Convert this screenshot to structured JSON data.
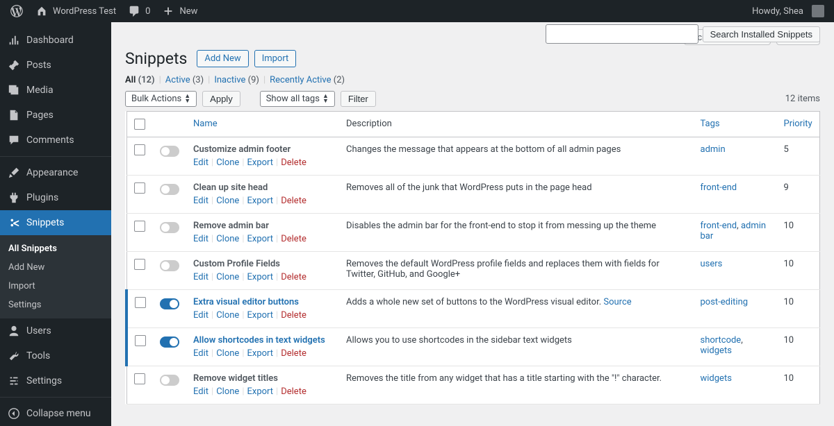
{
  "adminbar": {
    "site_name": "WordPress Test",
    "comment_count": "0",
    "new_label": "New",
    "howdy": "Howdy, Shea"
  },
  "sidebar": {
    "items": [
      {
        "icon": "dashboard",
        "label": "Dashboard"
      },
      {
        "icon": "pin",
        "label": "Posts"
      },
      {
        "icon": "media",
        "label": "Media"
      },
      {
        "icon": "page",
        "label": "Pages"
      },
      {
        "icon": "comment",
        "label": "Comments"
      },
      {
        "sep": true
      },
      {
        "icon": "brush",
        "label": "Appearance"
      },
      {
        "icon": "plugin",
        "label": "Plugins"
      },
      {
        "icon": "scissors",
        "label": "Snippets",
        "active": true,
        "submenu": [
          "All Snippets",
          "Add New",
          "Import",
          "Settings"
        ],
        "submenu_active": 0
      },
      {
        "icon": "user",
        "label": "Users"
      },
      {
        "icon": "tool",
        "label": "Tools"
      },
      {
        "icon": "settings",
        "label": "Settings"
      },
      {
        "sep": true
      },
      {
        "icon": "collapse",
        "label": "Collapse menu"
      }
    ]
  },
  "top": {
    "screen_options": "Screen Options",
    "help": "Help"
  },
  "header": {
    "title": "Snippets",
    "add_new": "Add New",
    "import": "Import"
  },
  "search": {
    "button": "Search Installed Snippets"
  },
  "views": [
    {
      "label": "All",
      "count": "(12)",
      "current": true
    },
    {
      "label": "Active",
      "count": "(3)"
    },
    {
      "label": "Inactive",
      "count": "(9)"
    },
    {
      "label": "Recently Active",
      "count": "(2)"
    }
  ],
  "bulk": {
    "actions_label": "Bulk Actions",
    "apply": "Apply",
    "tags_label": "Show all tags",
    "filter": "Filter"
  },
  "pagination": {
    "items": "12 items"
  },
  "columns": {
    "name": "Name",
    "description": "Description",
    "tags": "Tags",
    "priority": "Priority"
  },
  "row_actions": {
    "edit": "Edit",
    "clone": "Clone",
    "export": "Export",
    "delete": "Delete"
  },
  "snippets": [
    {
      "title": "Customize admin footer",
      "desc": "Changes the message that appears at the bottom of all admin pages",
      "tags": [
        "admin"
      ],
      "priority": "5",
      "active": false
    },
    {
      "title": "Clean up site head",
      "desc": "Removes all of the junk that WordPress puts in the page head",
      "tags": [
        "front-end"
      ],
      "priority": "9",
      "active": false
    },
    {
      "title": "Remove admin bar",
      "desc": "Disables the admin bar for the front-end to stop it from messing up the theme",
      "tags": [
        "front-end",
        "admin bar"
      ],
      "priority": "10",
      "active": false
    },
    {
      "title": "Custom Profile Fields",
      "desc": "Removes the default WordPress profile fields and replaces them with fields for Twitter, GitHub, and Google+",
      "tags": [
        "users"
      ],
      "priority": "10",
      "active": false
    },
    {
      "title": "Extra visual editor buttons",
      "desc": "Adds a whole new set of buttons to the WordPress visual editor.",
      "source": "Source",
      "tags": [
        "post-editing"
      ],
      "priority": "10",
      "active": true
    },
    {
      "title": "Allow shortcodes in text widgets",
      "desc": "Allows you to use shortcodes in the sidebar text widgets",
      "tags": [
        "shortcode",
        "widgets"
      ],
      "priority": "10",
      "active": true
    },
    {
      "title": "Remove widget titles",
      "desc": "Removes the title from any widget that has a title starting with the \"!\" character.",
      "tags": [
        "widgets"
      ],
      "priority": "10",
      "active": false
    }
  ]
}
